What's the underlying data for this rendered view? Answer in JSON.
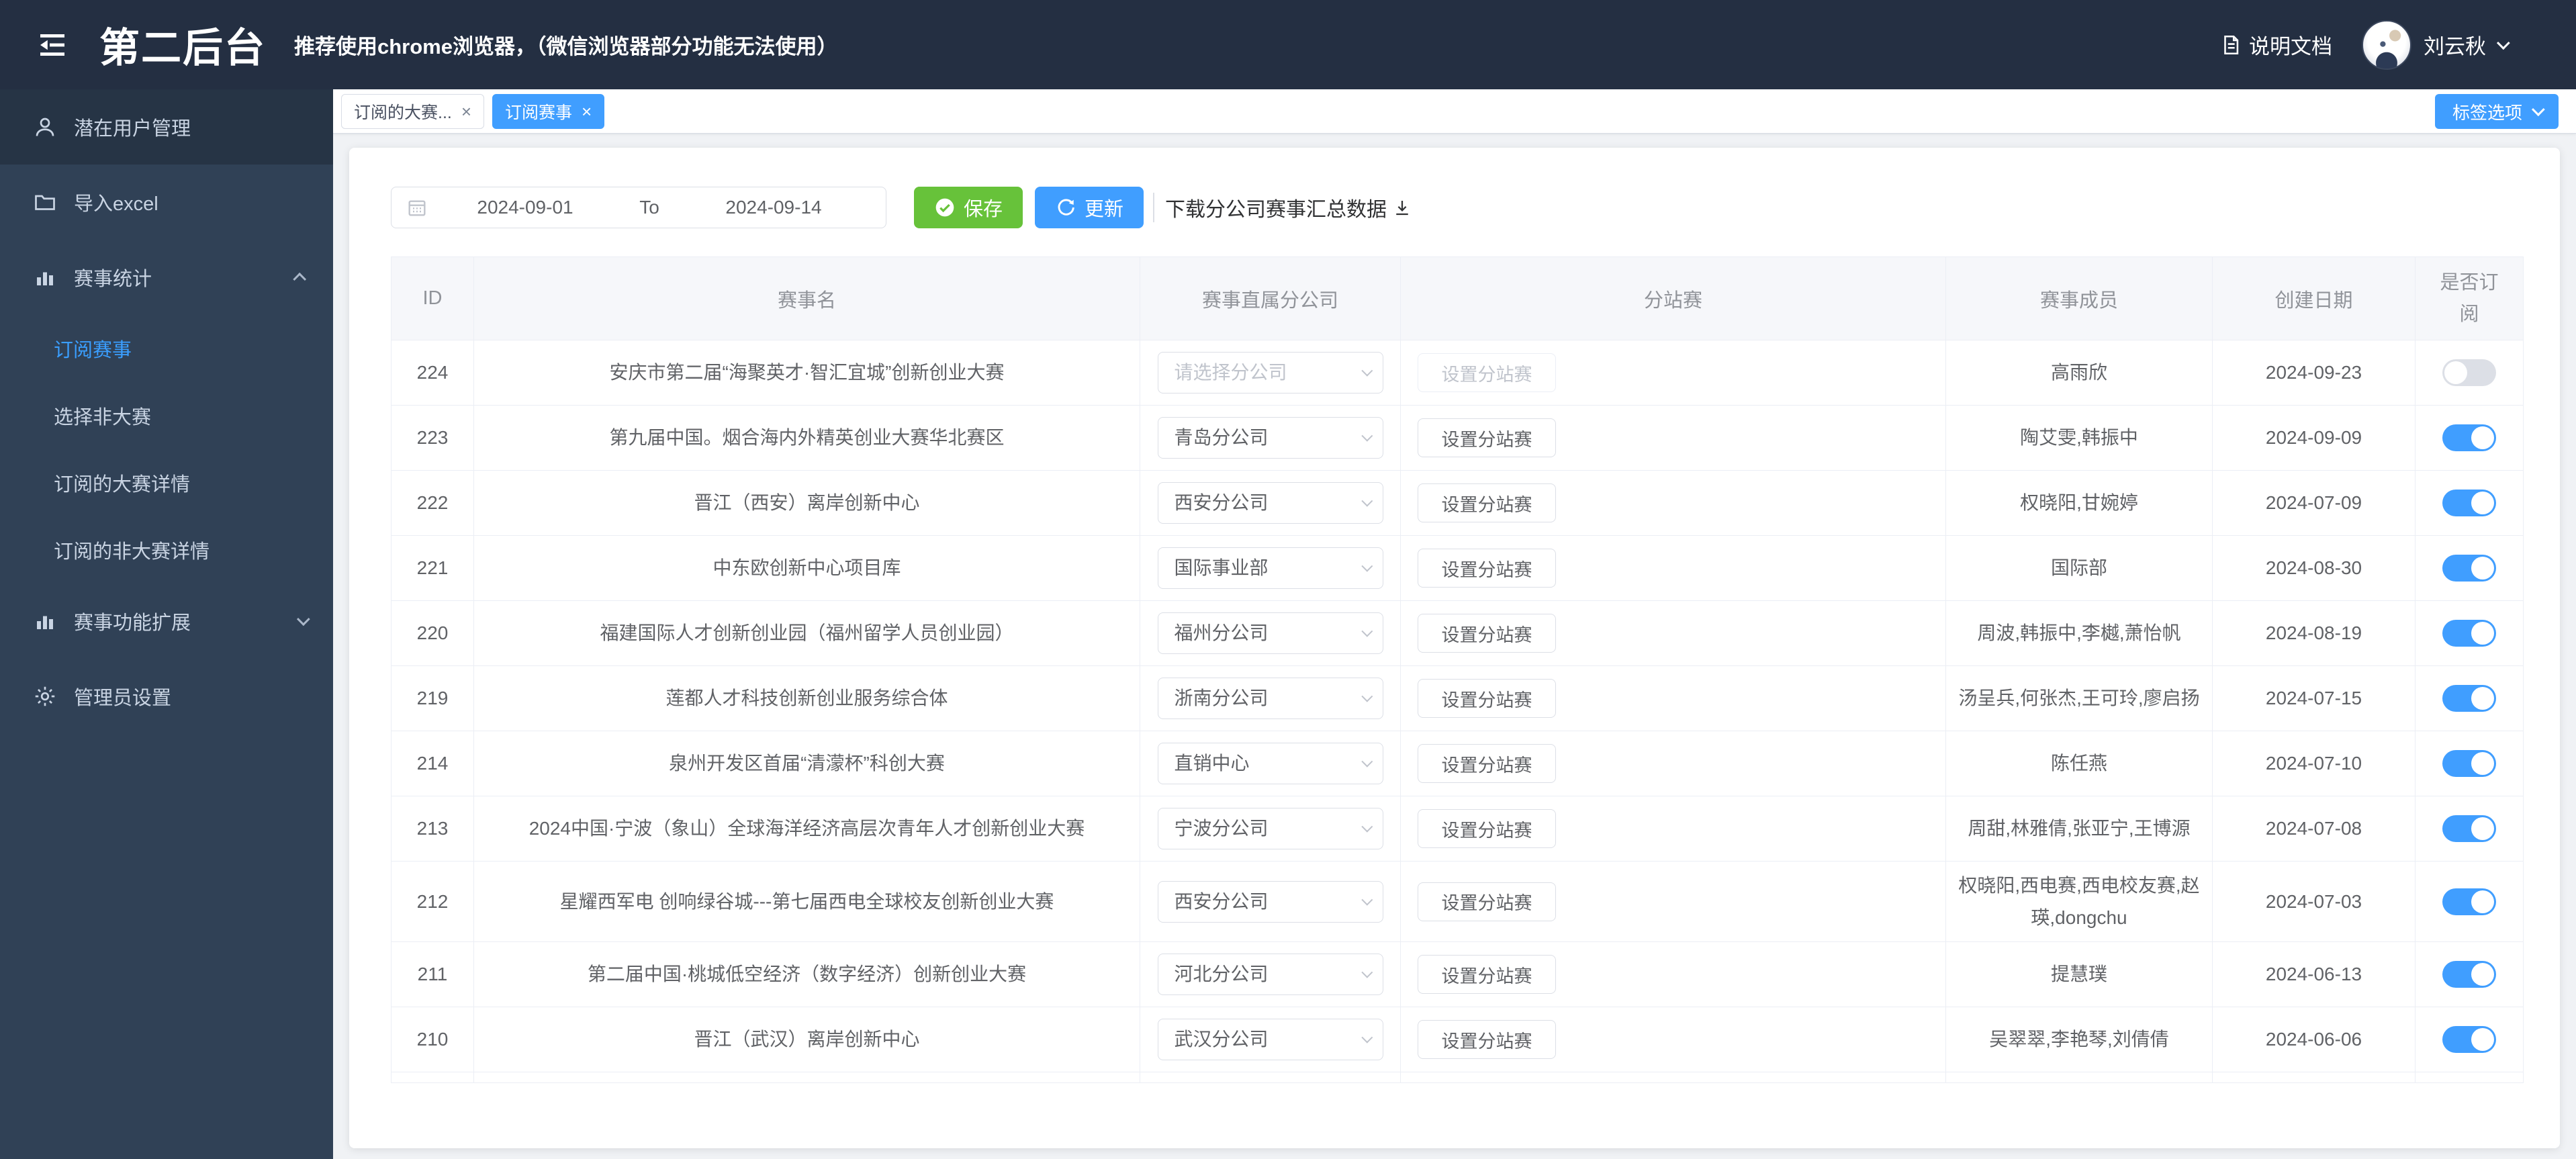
{
  "header": {
    "title": "第二后台",
    "subtitle": "推荐使用chrome浏览器，（微信浏览器部分功能无法使用）",
    "docs_label": "说明文档",
    "username": "刘云秋"
  },
  "sidebar": {
    "items": [
      {
        "label": "潜在用户管理",
        "icon": "user-icon"
      },
      {
        "label": "导入excel",
        "icon": "folder-icon"
      },
      {
        "label": "赛事统计",
        "icon": "bar-chart-icon",
        "expanded": true,
        "children": [
          "订阅赛事",
          "选择非大赛",
          "订阅的大赛详情",
          "订阅的非大赛详情"
        ],
        "active_child": "订阅赛事"
      },
      {
        "label": "赛事功能扩展",
        "icon": "bar-chart-icon",
        "expanded": false
      },
      {
        "label": "管理员设置",
        "icon": "gear-icon"
      }
    ]
  },
  "tabs": {
    "items": [
      {
        "label": "订阅的大赛...",
        "active": false
      },
      {
        "label": "订阅赛事",
        "active": true
      }
    ],
    "options_button": "标签选项"
  },
  "toolbar": {
    "date_start": "2024-09-01",
    "date_separator": "To",
    "date_end": "2024-09-14",
    "save_label": "保存",
    "update_label": "更新",
    "download_label": "下载分公司赛事汇总数据"
  },
  "table": {
    "columns": [
      "ID",
      "赛事名",
      "赛事直属分公司",
      "分站赛",
      "赛事成员",
      "创建日期",
      "是否订阅"
    ],
    "select_placeholder": "请选择分公司",
    "branch_button_label": "设置分站赛",
    "rows": [
      {
        "id": "224",
        "name": "安庆市第二届“海聚英才·智汇宜城”创新创业大赛",
        "company": "",
        "members": "高雨欣",
        "created": "2024-09-23",
        "subscribed": false,
        "branch_button_disabled": true
      },
      {
        "id": "223",
        "name": "第九届中国。烟合海内外精英创业大赛华北赛区",
        "company": "青岛分公司",
        "members": "陶艾雯,韩振中",
        "created": "2024-09-09",
        "subscribed": true,
        "branch_button_disabled": false
      },
      {
        "id": "222",
        "name": "晋江（西安）离岸创新中心",
        "company": "西安分公司",
        "members": "权晓阳,甘婉婷",
        "created": "2024-07-09",
        "subscribed": true,
        "branch_button_disabled": false
      },
      {
        "id": "221",
        "name": "中东欧创新中心项目库",
        "company": "国际事业部",
        "members": "国际部",
        "created": "2024-08-30",
        "subscribed": true,
        "branch_button_disabled": false
      },
      {
        "id": "220",
        "name": "福建国际人才创新创业园（福州留学人员创业园）",
        "company": "福州分公司",
        "members": "周波,韩振中,李樾,萧怡帆",
        "created": "2024-08-19",
        "subscribed": true,
        "branch_button_disabled": false
      },
      {
        "id": "219",
        "name": "莲都人才科技创新创业服务综合体",
        "company": "浙南分公司",
        "members": "汤呈兵,何张杰,王可玲,廖启扬",
        "created": "2024-07-15",
        "subscribed": true,
        "branch_button_disabled": false
      },
      {
        "id": "214",
        "name": "泉州开发区首届“清濛杯”科创大赛",
        "company": "直销中心",
        "members": "陈任燕",
        "created": "2024-07-10",
        "subscribed": true,
        "branch_button_disabled": false
      },
      {
        "id": "213",
        "name": "2024中国·宁波（象山）全球海洋经济高层次青年人才创新创业大赛",
        "company": "宁波分公司",
        "members": "周甜,林雅倩,张亚宁,王博源",
        "created": "2024-07-08",
        "subscribed": true,
        "branch_button_disabled": false
      },
      {
        "id": "212",
        "name": "星耀西军电 创响绿谷城---第七届西电全球校友创新创业大赛",
        "company": "西安分公司",
        "members": "权晓阳,西电赛,西电校友赛,赵瑛,dongchu",
        "created": "2024-07-03",
        "subscribed": true,
        "branch_button_disabled": false
      },
      {
        "id": "211",
        "name": "第二届中国·桃城低空经济（数字经济）创新创业大赛",
        "company": "河北分公司",
        "members": "提慧璞",
        "created": "2024-06-13",
        "subscribed": true,
        "branch_button_disabled": false
      },
      {
        "id": "210",
        "name": "晋江（武汉）离岸创新中心",
        "company": "武汉分公司",
        "members": "吴翠翠,李艳琴,刘倩倩",
        "created": "2024-06-06",
        "subscribed": true,
        "branch_button_disabled": false
      }
    ]
  },
  "colors": {
    "accent": "#409eff",
    "success": "#67c23a",
    "header_bg": "#242f42",
    "sidebar_bg": "#304156",
    "page_bg": "#f0f2f5",
    "toggle_off": "#dcdfe6",
    "table_border": "#ebeef5"
  }
}
